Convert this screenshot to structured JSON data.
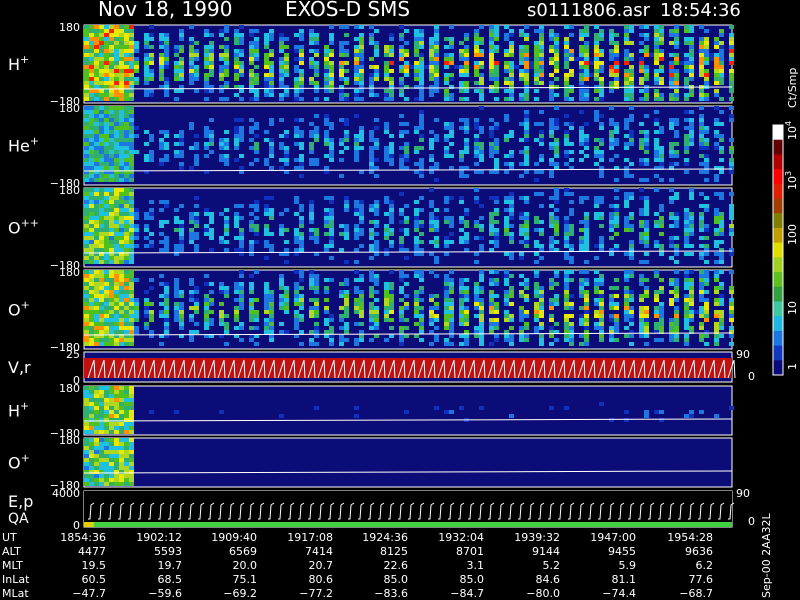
{
  "header": {
    "date": "Nov 18, 1990",
    "instrument": "EXOS-D SMS",
    "file": "s0111806.asr",
    "time": "18:54:36"
  },
  "chart_data": {
    "type": "heatmap",
    "time_range": [
      "18:54:36",
      "19:54:28"
    ],
    "panels": [
      {
        "label": "H",
        "superscript": "+",
        "ytop": "180",
        "ybot": "−180",
        "intensity": 1.05,
        "startup": 1.0,
        "trend": 0.7,
        "seed": 11,
        "kind": "spec"
      },
      {
        "label": "He",
        "superscript": "+",
        "ytop": "180",
        "ybot": "−180",
        "intensity": 0.55,
        "startup": 0.6,
        "trend": 0.6,
        "seed": 23,
        "kind": "spec"
      },
      {
        "label": "O",
        "superscript": "++",
        "ytop": "180",
        "ybot": "−180",
        "intensity": 0.6,
        "startup": 0.8,
        "trend": 0.7,
        "seed": 37,
        "kind": "spec"
      },
      {
        "label": "O",
        "superscript": "+",
        "ytop": "180",
        "ybot": "−180",
        "intensity": 0.85,
        "startup": 0.9,
        "trend": 0.8,
        "seed": 41,
        "kind": "spec"
      },
      {
        "label": "V,r",
        "superscript": "",
        "ytop": "25",
        "ybot": "0",
        "right_top": "90",
        "right_bot": "0",
        "kind": "vr"
      },
      {
        "label": "H",
        "superscript": "+",
        "ytop": "180",
        "ybot": "−180",
        "intensity": 0.25,
        "startup": 0.9,
        "trend": 0.6,
        "seed": 53,
        "kind": "spec"
      },
      {
        "label": "O",
        "superscript": "+",
        "ytop": "180",
        "ybot": "−180",
        "intensity": 0.05,
        "startup": 0.8,
        "trend": 0.0,
        "seed": 67,
        "kind": "spec"
      },
      {
        "label": "E,p",
        "label2": "QA",
        "superscript": "",
        "ytop": "4000",
        "ybot": "0",
        "right_top": "90",
        "right_bot": "0",
        "kind": "ep"
      }
    ],
    "colorbar": {
      "unit": "Ct/Smp",
      "ticks": [
        {
          "label": "1",
          "exp": ""
        },
        {
          "label": "10",
          "exp": ""
        },
        {
          "label": "100",
          "exp": ""
        },
        {
          "label": "10",
          "exp": "3"
        },
        {
          "label": "10",
          "exp": "4"
        }
      ],
      "colors": [
        "#0a0a7a",
        "#1038c0",
        "#1c78e0",
        "#20b8e0",
        "#40c8a0",
        "#30a040",
        "#60c020",
        "#a0d020",
        "#e0e000",
        "#c0a000",
        "#808000",
        "#a04000",
        "#e02000",
        "#ff0000",
        "#b00000",
        "#600000",
        "#ffffff"
      ]
    },
    "table": {
      "row_labels": [
        "UT",
        "ALT",
        "MLT",
        "InLat",
        "MLat"
      ],
      "columns": [
        [
          "1854:36",
          "4477",
          "19.5",
          "60.5",
          "−47.7"
        ],
        [
          "1902:12",
          "5593",
          "19.7",
          "68.5",
          "−59.6"
        ],
        [
          "1909:40",
          "6569",
          "20.0",
          "75.1",
          "−69.2"
        ],
        [
          "1917:08",
          "7414",
          "20.7",
          "80.6",
          "−77.2"
        ],
        [
          "1924:36",
          "8125",
          "22.6",
          "85.0",
          "−83.6"
        ],
        [
          "1932:04",
          "8701",
          "3.1",
          "85.0",
          "−84.7"
        ],
        [
          "1939:32",
          "9144",
          "5.2",
          "84.6",
          "−80.0"
        ],
        [
          "1947:00",
          "9455",
          "5.9",
          "81.1",
          "−74.4"
        ],
        [
          "1954:28",
          "9636",
          "6.2",
          "77.6",
          "−68.7"
        ]
      ]
    },
    "footer_note": "Sep-00  2AA32L"
  }
}
